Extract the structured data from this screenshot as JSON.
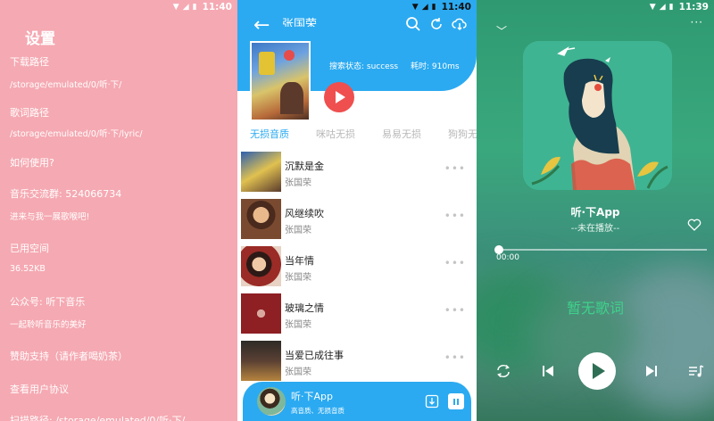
{
  "status_bar": {
    "panel1_time": "11:40",
    "panel2_time": "11:40",
    "panel3_time": "11:39"
  },
  "settings": {
    "title": "设置",
    "download_path_label": "下载路径",
    "download_path_value": "/storage/emulated/0/听·下/",
    "lyric_path_label": "歌词路径",
    "lyric_path_value": "/storage/emulated/0/听·下/lyric/",
    "how_to_use": "如何使用?",
    "group_label": "音乐交流群: 524066734",
    "group_sub": "进来与我一展歌喉吧!",
    "used_space_label": "已用空间",
    "used_space_value": "36.52KB",
    "wechat_label": "公众号: 听下音乐",
    "wechat_sub": "一起聆听音乐的美好",
    "sponsor": "赞助支持（请作者喝奶茶）",
    "agreement": "查看用户协议",
    "scan_path": "扫描路径: /storage/emulated/0/听·下/"
  },
  "search": {
    "back_label": "←",
    "header_title": "张国荣",
    "status_text": "搜索状态: success",
    "time_text": "耗时: 910ms",
    "tabs": [
      "无损音质",
      "咪咕无损",
      "易易无损",
      "狗狗无"
    ],
    "songs": [
      {
        "name": "沉默是金",
        "artist": "张国荣"
      },
      {
        "name": "风继续吹",
        "artist": "张国荣"
      },
      {
        "name": "当年情",
        "artist": "张国荣"
      },
      {
        "name": "玻璃之情",
        "artist": "张国荣"
      },
      {
        "name": "当爱已成往事",
        "artist": "张国荣"
      }
    ],
    "more_label": "•••",
    "mini_player": {
      "title": "听·下App",
      "subtitle": "高音质、无损音质"
    }
  },
  "player": {
    "collapse_label": "﹀",
    "menu_label": "···",
    "title": "听·下App",
    "subtitle": "--未在播放--",
    "time": "00:00",
    "progress": 0,
    "no_lyrics": "暂无歌词"
  },
  "colors": {
    "settings_bg": "#f5a9b2",
    "accent_blue": "#2baaf1",
    "play_red": "#ef4f4f",
    "player_green": "#3aa87d",
    "lyric_green": "#3fd18c"
  }
}
